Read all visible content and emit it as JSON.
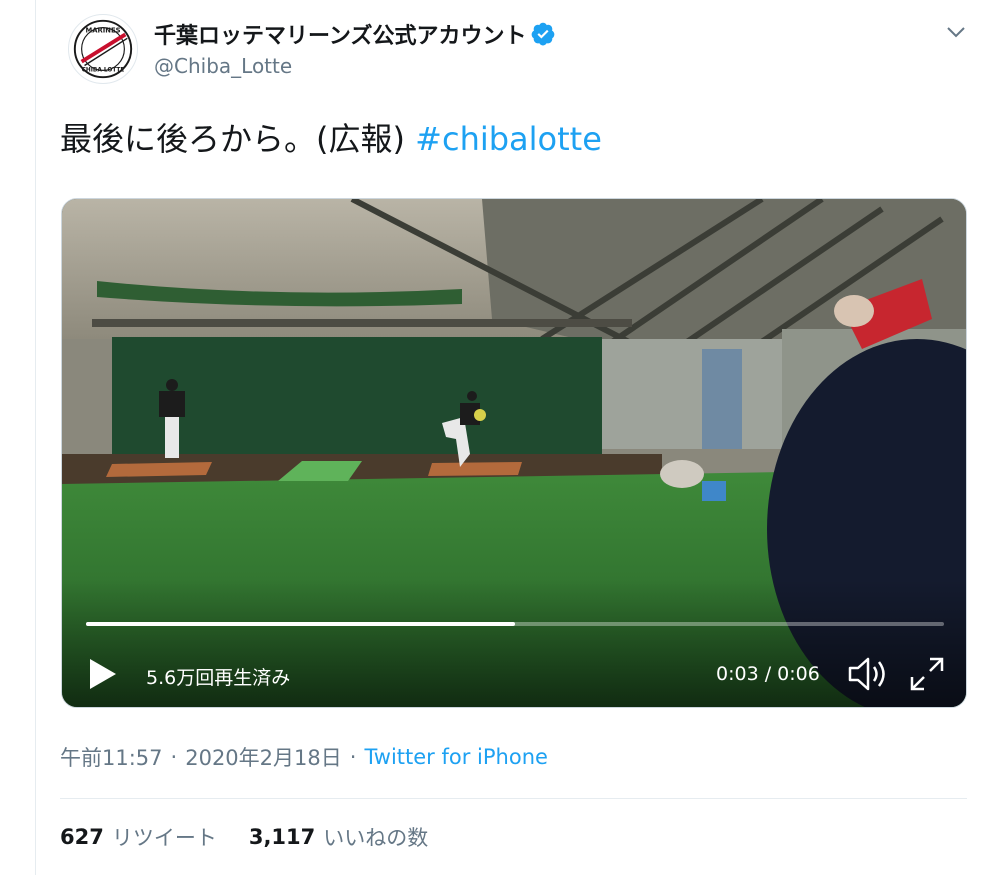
{
  "author": {
    "display_name": "千葉ロッテマリーンズ公式アカウント",
    "handle": "@Chiba_Lotte",
    "verified_icon": "verified-badge-icon",
    "avatar_icon": "chiba-lotte-marines-logo-icon",
    "logo_text_top": "MARINES",
    "logo_text_bottom": "CHIBA LOTTE"
  },
  "tweet": {
    "text": "最後に後ろから。(広報) ",
    "hashtag": "#chibalotte"
  },
  "video": {
    "progress": 0.5,
    "views": "5.6万回再生済み",
    "time": "0:03 / 0:06",
    "play_icon": "play-icon",
    "volume_icon": "volume-icon",
    "fullscreen_icon": "fullscreen-icon"
  },
  "meta": {
    "time": "午前11:57",
    "sep1": "·",
    "date": "2020年2月18日",
    "sep2": "·",
    "source": "Twitter for iPhone"
  },
  "stats": {
    "retweets_count": "627",
    "retweets_label": "リツイート",
    "likes_count": "3,117",
    "likes_label": "いいねの数"
  },
  "colors": {
    "link": "#1da1f2",
    "secondary": "#657786",
    "text": "#14171a"
  }
}
